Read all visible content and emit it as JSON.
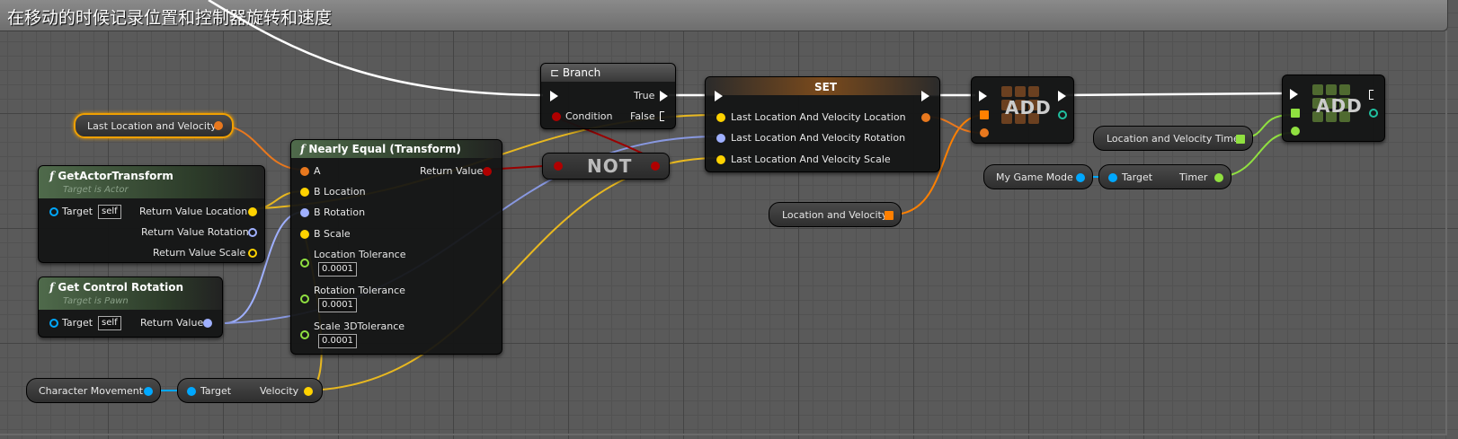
{
  "comment": {
    "title": "在移动的时候记录位置和控制器旋转和速度"
  },
  "colors": {
    "exec": "#ffffff",
    "bool": "#8c0000",
    "struct": "#f0a000",
    "vector": "#ffd200",
    "rotator": "#9fb0ff",
    "float": "#90e040",
    "object": "#00a8ff",
    "map": "#ff8000",
    "set_green": "#90e040"
  },
  "nodes": {
    "last_location_var": {
      "label": "Last Location and Velocity"
    },
    "get_actor_transform": {
      "title": "GetActorTransform",
      "subtitle": "Target is Actor",
      "target": "Target",
      "self": "self",
      "out_location": "Return Value Location",
      "out_rotation": "Return Value Rotation",
      "out_scale": "Return Value Scale"
    },
    "get_control_rotation": {
      "title": "Get Control Rotation",
      "subtitle": "Target is Pawn",
      "target": "Target",
      "self": "self",
      "out_return": "Return Value"
    },
    "nearly_equal": {
      "title": "Nearly Equal (Transform)",
      "a": "A",
      "b_location": "B Location",
      "b_rotation": "B Rotation",
      "b_scale": "B Scale",
      "loc_tol": "Location Tolerance",
      "loc_tol_val": "0.0001",
      "rot_tol": "Rotation Tolerance",
      "rot_tol_val": "0.0001",
      "scale_tol": "Scale 3DTolerance",
      "scale_tol_val": "0.0001",
      "out_return": "Return Value"
    },
    "branch": {
      "title": "Branch",
      "condition": "Condition",
      "true_label": "True",
      "false_label": "False"
    },
    "not_node": {
      "title": "NOT"
    },
    "set_node": {
      "title": "SET",
      "loc": "Last Location And Velocity Location",
      "rot": "Last Location And Velocity Rotation",
      "scale": "Last Location And Velocity Scale"
    },
    "add1": {
      "title": "ADD"
    },
    "add2": {
      "title": "ADD"
    },
    "location_velocity_var": {
      "label": "Location and Velocity"
    },
    "location_velocity_time_var": {
      "label": "Location and Velocity Time"
    },
    "my_game_mode": {
      "label": "My Game Mode"
    },
    "timer_get": {
      "target": "Target",
      "out": "Timer"
    },
    "character_movement": {
      "label": "Character Movement"
    },
    "velocity_get": {
      "target": "Target",
      "out": "Velocity"
    }
  }
}
